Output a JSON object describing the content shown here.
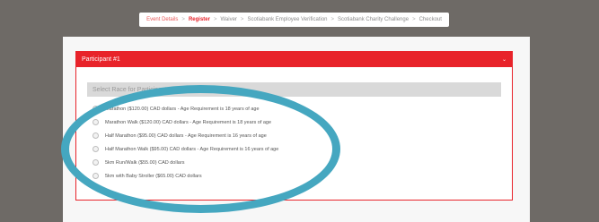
{
  "breadcrumb": [
    {
      "label": "Event Details",
      "state": "done"
    },
    {
      "label": "Register",
      "state": "active"
    },
    {
      "label": "Waiver",
      "state": "todo"
    },
    {
      "label": "Scotiabank Employee Verification",
      "state": "todo"
    },
    {
      "label": "Scotiabank Charity Challenge",
      "state": "todo"
    },
    {
      "label": "Checkout",
      "state": "todo"
    }
  ],
  "breadcrumb_separator": ">",
  "panel": {
    "title": "Participant #1",
    "chevron_icon": "chevron-down-icon",
    "select_placeholder": "Select Race for Participant 1",
    "options": [
      "Marathon ($120.00) CAD dollars - Age Requirement is 18 years of age",
      "Marathon Walk ($120.00) CAD dollars - Age Requirement is 18 years of age",
      "Half Marathon ($95.00) CAD dollars - Age Requirement is 16 years of age",
      "Half Marathon Walk ($95.00) CAD dollars - Age Requirement is 16 years of age",
      "5km Run/Walk ($55.00) CAD dollars",
      "5km with Baby Stroller ($65.00) CAD dollars"
    ]
  },
  "colors": {
    "accent": "#e8232a",
    "highlight_ellipse": "#45a7c0",
    "background": "#6e6a66"
  }
}
